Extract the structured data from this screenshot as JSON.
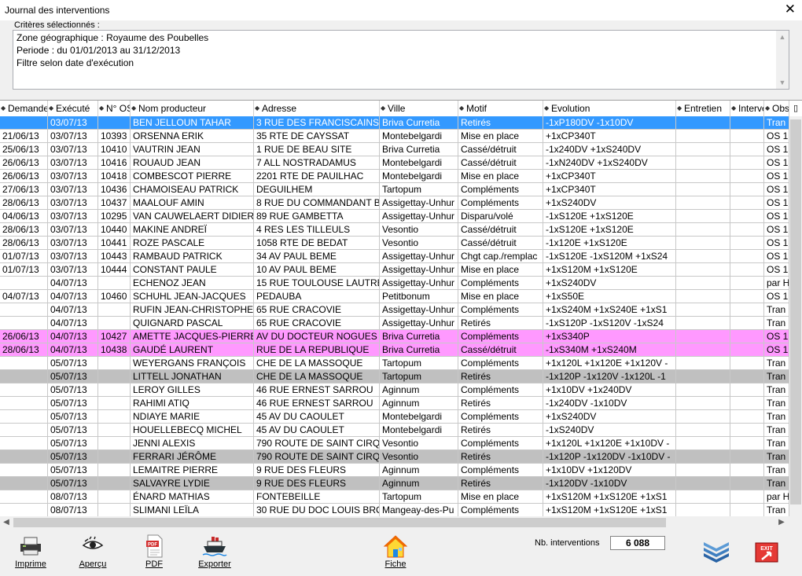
{
  "window": {
    "title": "Journal des interventions",
    "close_glyph": "✕"
  },
  "criteria": {
    "label": "Critères sélectionnés :",
    "lines": [
      "Zone géographique : Royaume des Poubelles",
      "Periode : du 01/01/2013 au 31/12/2013",
      "Filtre selon date d'exécution"
    ]
  },
  "columns": [
    "Demande",
    "Exécuté",
    "N° OS",
    "Nom producteur",
    "Adresse",
    "Ville",
    "Motif",
    "Evolution",
    "Entretien",
    "Interver",
    "Obs"
  ],
  "rows": [
    {
      "style": "sel",
      "cells": [
        "",
        "03/07/13",
        "",
        "BEN JELLOUN TAHAR",
        "3 RUE DES FRANCISCAINS",
        "Briva Curretia",
        "Retirés",
        "-1xP180DV -1x10DV",
        "",
        "",
        "Tran"
      ]
    },
    {
      "style": "",
      "cells": [
        "21/06/13",
        "03/07/13",
        "10393",
        "ORSENNA ERIK",
        "35 RTE DE CAYSSAT",
        "Montebelgardi",
        "Mise en place",
        "+1xCP340T",
        "",
        "",
        "OS 1"
      ]
    },
    {
      "style": "",
      "cells": [
        "25/06/13",
        "03/07/13",
        "10410",
        "VAUTRIN JEAN",
        "1 RUE DE BEAU SITE",
        "Briva Curretia",
        "Cassé/détruit",
        "-1x240DV +1xS240DV",
        "",
        "",
        "OS 1"
      ]
    },
    {
      "style": "",
      "cells": [
        "26/06/13",
        "03/07/13",
        "10416",
        "ROUAUD JEAN",
        "7 ALL NOSTRADAMUS",
        "Montebelgardi",
        "Cassé/détruit",
        "-1xN240DV +1xS240DV",
        "",
        "",
        "OS 1"
      ]
    },
    {
      "style": "",
      "cells": [
        "26/06/13",
        "03/07/13",
        "10418",
        "COMBESCOT PIERRE",
        "2201 RTE DE PAUILHAC",
        "Montebelgardi",
        "Mise en place",
        "+1xCP340T",
        "",
        "",
        "OS 1"
      ]
    },
    {
      "style": "",
      "cells": [
        "27/06/13",
        "03/07/13",
        "10436",
        "CHAMOISEAU PATRICK",
        "DEGUILHEM",
        "Tartopum",
        "Compléments",
        "+1xCP340T",
        "",
        "",
        "OS 1"
      ]
    },
    {
      "style": "",
      "cells": [
        "28/06/13",
        "03/07/13",
        "10437",
        "MAALOUF AMIN",
        "8 RUE DU COMMANDANT B",
        "Assigettay-Unhur",
        "Compléments",
        "+1xS240DV",
        "",
        "",
        "OS 1"
      ]
    },
    {
      "style": "",
      "cells": [
        "04/06/13",
        "03/07/13",
        "10295",
        "VAN CAUWELAERT DIDIER",
        "89 RUE GAMBETTA",
        "Assigettay-Unhur",
        "Disparu/volé",
        "-1xS120E +1xS120E",
        "",
        "",
        "OS 1"
      ]
    },
    {
      "style": "",
      "cells": [
        "28/06/13",
        "03/07/13",
        "10440",
        "MAKINE ANDREÏ",
        "4 RES LES TILLEULS",
        "Vesontio",
        "Cassé/détruit",
        "-1xS120E +1xS120E",
        "",
        "",
        "OS 1"
      ]
    },
    {
      "style": "",
      "cells": [
        "28/06/13",
        "03/07/13",
        "10441",
        "ROZE PASCALE",
        "1058 RTE DE BEDAT",
        "Vesontio",
        "Cassé/détruit",
        "-1x120E +1xS120E",
        "",
        "",
        "OS 1"
      ]
    },
    {
      "style": "",
      "cells": [
        "01/07/13",
        "03/07/13",
        "10443",
        "RAMBAUD PATRICK",
        "34 AV PAUL BEME",
        "Assigettay-Unhur",
        "Chgt cap./remplac",
        "-1xS120E -1xS120M +1xS24",
        "",
        "",
        "OS 1"
      ]
    },
    {
      "style": "",
      "cells": [
        "01/07/13",
        "03/07/13",
        "10444",
        "CONSTANT PAULE",
        "10 AV PAUL BEME",
        "Assigettay-Unhur",
        "Mise en place",
        "+1xS120M +1xS120E",
        "",
        "",
        "OS 1"
      ]
    },
    {
      "style": "",
      "cells": [
        "",
        "04/07/13",
        "",
        "ECHENOZ JEAN",
        "15 RUE TOULOUSE LAUTRE",
        "Assigettay-Unhur",
        "Compléments",
        "+1xS240DV",
        "",
        "",
        "par H"
      ]
    },
    {
      "style": "",
      "cells": [
        "04/07/13",
        "04/07/13",
        "10460",
        "SCHUHL JEAN-JACQUES",
        "PEDAUBA",
        "Petitbonum",
        "Mise en place",
        "+1xS50E",
        "",
        "",
        "OS 1"
      ]
    },
    {
      "style": "",
      "cells": [
        "",
        "04/07/13",
        "",
        "RUFIN JEAN-CHRISTOPHE",
        "65 RUE CRACOVIE",
        "Assigettay-Unhur",
        "Compléments",
        "+1xS240M +1xS240E +1xS1",
        "",
        "",
        "Tran"
      ]
    },
    {
      "style": "",
      "cells": [
        "",
        "04/07/13",
        "",
        "QUIGNARD PASCAL",
        "65 RUE CRACOVIE",
        "Assigettay-Unhur",
        "Retirés",
        "-1xS120P -1xS120V -1xS24",
        "",
        "",
        "Tran"
      ]
    },
    {
      "style": "pink",
      "cells": [
        "26/06/13",
        "04/07/13",
        "10427",
        "AMETTE JACQUES-PIERRE",
        "AV DU DOCTEUR NOGUES",
        "Briva Curretia",
        "Compléments",
        "+1xS340P",
        "",
        "",
        "OS 1"
      ]
    },
    {
      "style": "pink",
      "cells": [
        "28/06/13",
        "04/07/13",
        "10438",
        "GAUDÉ LAURENT",
        "RUE DE LA REPUBLIQUE",
        "Briva Curretia",
        "Cassé/détruit",
        "-1xS340M +1xS240M",
        "",
        "",
        "OS 1"
      ]
    },
    {
      "style": "",
      "cells": [
        "",
        "05/07/13",
        "",
        "WEYERGANS FRANÇOIS",
        "CHE DE LA MASSOQUE",
        "Tartopum",
        "Compléments",
        "+1x120L +1x120E +1x120V -",
        "",
        "",
        "Tran"
      ]
    },
    {
      "style": "grey",
      "cells": [
        "",
        "05/07/13",
        "",
        "LITTELL JONATHAN",
        "CHE DE LA MASSOQUE",
        "Tartopum",
        "Retirés",
        "-1x120P -1x120V -1x120L -1",
        "",
        "",
        "Tran"
      ]
    },
    {
      "style": "",
      "cells": [
        "",
        "05/07/13",
        "",
        "LEROY GILLES",
        "46 RUE ERNEST SARROU",
        "Aginnum",
        "Compléments",
        "+1x10DV +1x240DV",
        "",
        "",
        "Tran"
      ]
    },
    {
      "style": "",
      "cells": [
        "",
        "05/07/13",
        "",
        "RAHIMI ATIQ",
        "46 RUE ERNEST SARROU",
        "Aginnum",
        "Retirés",
        "-1x240DV -1x10DV",
        "",
        "",
        "Tran"
      ]
    },
    {
      "style": "",
      "cells": [
        "",
        "05/07/13",
        "",
        "NDIAYE MARIE",
        "45 AV DU CAOULET",
        "Montebelgardi",
        "Compléments",
        "+1xS240DV",
        "",
        "",
        "Tran"
      ]
    },
    {
      "style": "",
      "cells": [
        "",
        "05/07/13",
        "",
        "HOUELLEBECQ MICHEL",
        "45 AV DU CAOULET",
        "Montebelgardi",
        "Retirés",
        "-1xS240DV",
        "",
        "",
        "Tran"
      ]
    },
    {
      "style": "",
      "cells": [
        "",
        "05/07/13",
        "",
        "JENNI ALEXIS",
        "790 ROUTE DE SAINT CIRQ",
        "Vesontio",
        "Compléments",
        "+1x120L +1x120E +1x10DV -",
        "",
        "",
        "Tran"
      ]
    },
    {
      "style": "grey",
      "cells": [
        "",
        "05/07/13",
        "",
        "FERRARI JÉRÔME",
        "790 ROUTE DE SAINT CIRQ",
        "Vesontio",
        "Retirés",
        "-1x120P -1x120DV -1x10DV -",
        "",
        "",
        "Tran"
      ]
    },
    {
      "style": "",
      "cells": [
        "",
        "05/07/13",
        "",
        "LEMAITRE PIERRE",
        "9 RUE DES FLEURS",
        "Aginnum",
        "Compléments",
        "+1x10DV +1x120DV",
        "",
        "",
        "Tran"
      ]
    },
    {
      "style": "grey",
      "cells": [
        "",
        "05/07/13",
        "",
        "SALVAYRE LYDIE",
        "9 RUE DES FLEURS",
        "Aginnum",
        "Retirés",
        "-1x120DV -1x10DV",
        "",
        "",
        "Tran"
      ]
    },
    {
      "style": "",
      "cells": [
        "",
        "08/07/13",
        "",
        "ÉNARD MATHIAS",
        "FONTEBEILLE",
        "Tartopum",
        "Mise en place",
        "+1xS120M +1xS120E +1xS1",
        "",
        "",
        "par H"
      ]
    },
    {
      "style": "",
      "cells": [
        "",
        "08/07/13",
        "",
        "SLIMANI LEÏLA",
        "30 RUE DU DOC LOUIS BRO",
        "Mangeay-des-Pu",
        "Compléments",
        "+1xS120M +1xS120E +1xS1",
        "",
        "",
        "Tran"
      ]
    }
  ],
  "toolbar": {
    "print": "Imprime",
    "preview": "Aperçu",
    "pdf": "PDF",
    "export": "Exporter",
    "fiche": "Fiche",
    "pdf_icon_text": "PDF",
    "exit_icon_text": "EXIT"
  },
  "count": {
    "label": "Nb. interventions",
    "value": "6 088"
  },
  "colors": {
    "selected": "#3399ff",
    "pink": "#ff99ff",
    "grey": "#c0c0c0"
  }
}
